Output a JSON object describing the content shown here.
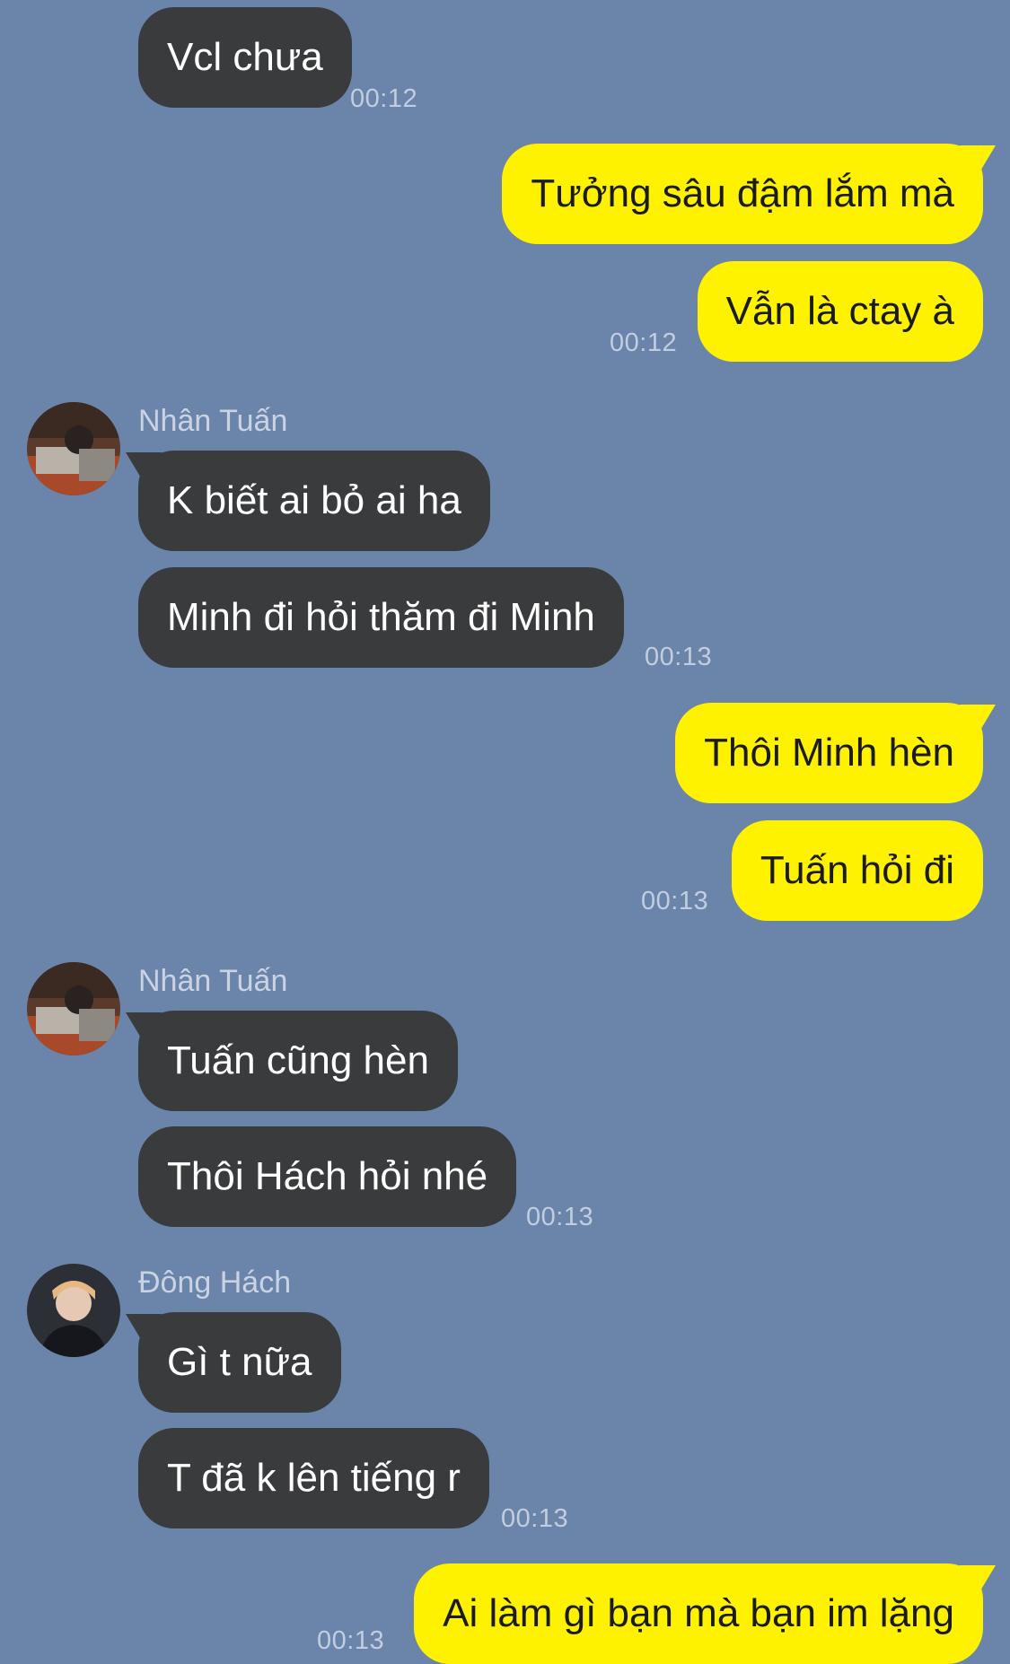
{
  "chat": {
    "messages": [
      {
        "text": "Vcl chưa",
        "time": "00:12"
      },
      {
        "text": "Tưởng sâu đậm lắm mà"
      },
      {
        "text": "Vẫn là ctay à",
        "time": "00:12"
      },
      {
        "sender": "Nhân Tuấn",
        "text": "K biết ai bỏ ai ha"
      },
      {
        "text": "Minh đi hỏi thăm đi Minh",
        "time": "00:13"
      },
      {
        "text": "Thôi Minh hèn"
      },
      {
        "text": "Tuấn hỏi đi",
        "time": "00:13"
      },
      {
        "sender": "Nhân Tuấn",
        "text": "Tuấn cũng hèn"
      },
      {
        "text": "Thôi Hách hỏi nhé",
        "time": "00:13"
      },
      {
        "sender": "Đông Hách",
        "text": "Gì t nữa"
      },
      {
        "text": "T đã k lên tiếng r",
        "time": "00:13"
      },
      {
        "text": "Ai làm gì bạn mà bạn im lặng",
        "time": "00:13"
      }
    ]
  },
  "colors": {
    "background": "#6b84aa",
    "incoming_bubble": "#3a3b3d",
    "outgoing_bubble": "#fef200",
    "timestamp": "#c2cde0"
  },
  "icons": {
    "avatar_1": "user-avatar-photo",
    "avatar_2": "user-avatar-photo",
    "avatar_3": "user-avatar-photo"
  }
}
